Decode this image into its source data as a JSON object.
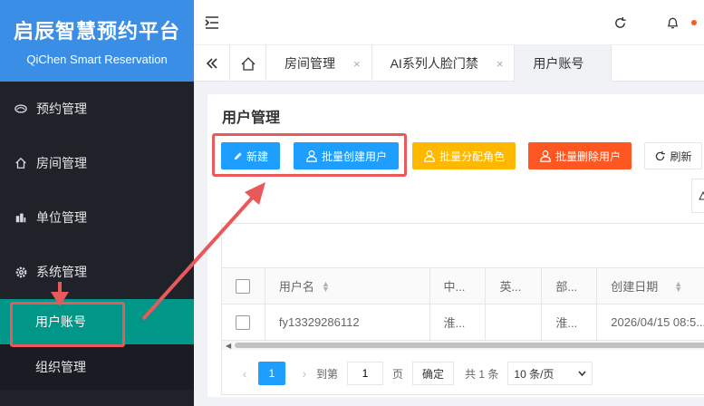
{
  "brand": {
    "title": "启辰智慧预约平台",
    "subtitle": "QiChen Smart Reservation"
  },
  "sidebar": {
    "items": [
      {
        "label": "预约管理",
        "icon": "eye-icon"
      },
      {
        "label": "房间管理",
        "icon": "home-icon"
      },
      {
        "label": "单位管理",
        "icon": "building-icon"
      },
      {
        "label": "系统管理",
        "icon": "gear-icon"
      }
    ],
    "sub_items": [
      {
        "label": "用户账号",
        "active": true
      },
      {
        "label": "组织管理",
        "active": false
      }
    ]
  },
  "header": {
    "icons": [
      "menu-fold-icon",
      "refresh-icon",
      "bell-icon"
    ]
  },
  "tabs": {
    "items": [
      {
        "label": "房间管理",
        "close": "×"
      },
      {
        "label": "AI系列人脸门禁",
        "close": "×"
      },
      {
        "label": "用户账号",
        "close": ""
      }
    ]
  },
  "card": {
    "title": "用户管理",
    "buttons": {
      "new": "新建",
      "batch_create": "批量创建用户",
      "batch_role": "批量分配角色",
      "batch_delete": "批量删除用户",
      "refresh": "刷新"
    }
  },
  "table": {
    "columns": [
      "用户名",
      "中...",
      "英...",
      "部...",
      "创建日期"
    ],
    "rows": [
      [
        "fy13329286112",
        "淮...",
        "",
        "淮...",
        "2026/04/15 08:5..."
      ]
    ]
  },
  "pager": {
    "current": "1",
    "goto_label": "到第",
    "page_input": "1",
    "page_unit": "页",
    "confirm": "确定",
    "total": "共 1 条",
    "page_size": "10 条/页"
  },
  "colors": {
    "brand": "#3a8ee6",
    "primary": "#1e9fff",
    "warn": "#ffb800",
    "danger": "#ff5722",
    "active_nav": "#009688",
    "annotation": "#e9585b"
  }
}
